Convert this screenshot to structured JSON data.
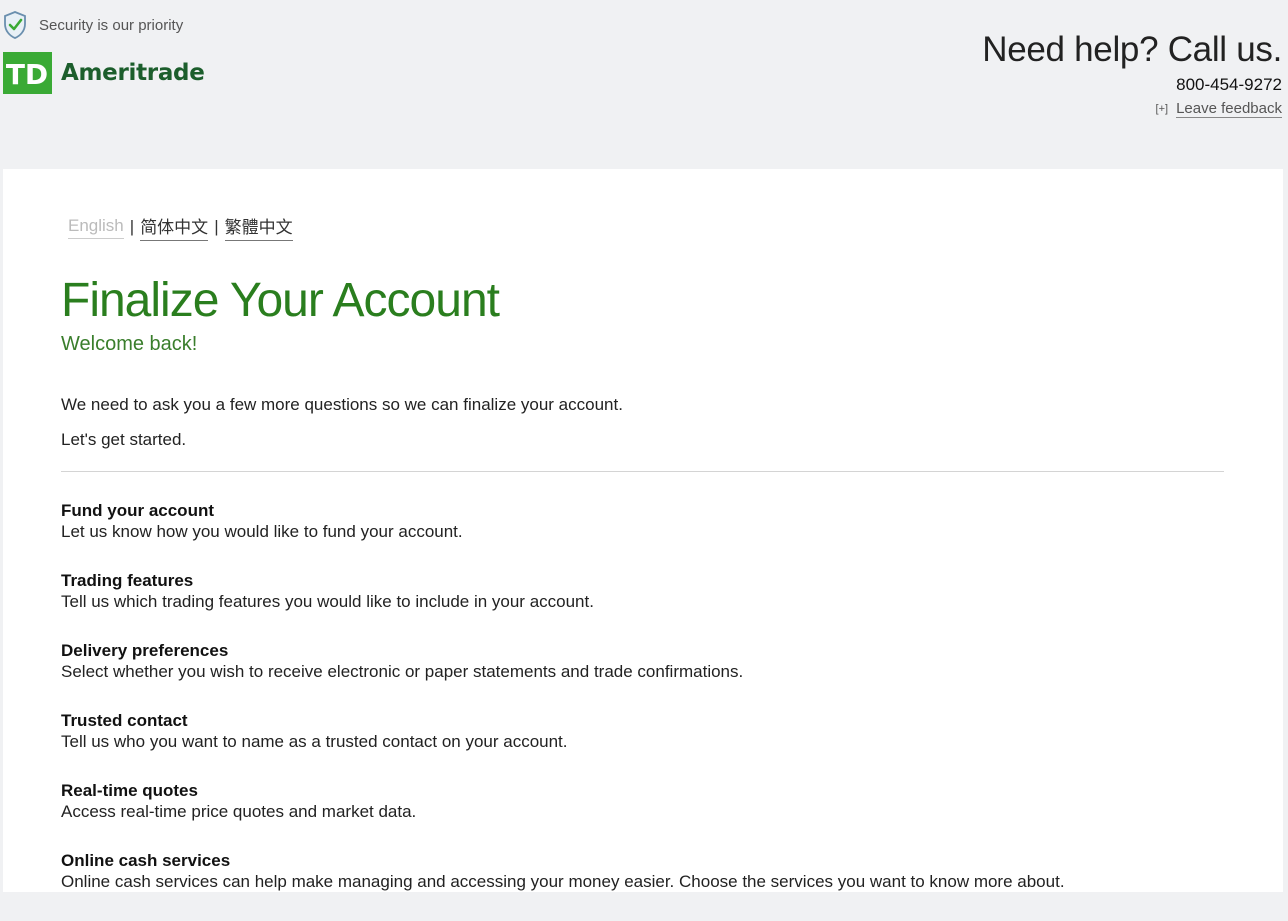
{
  "header": {
    "security_text": "Security is our priority",
    "logo_mark": "TD",
    "brand_name": "Ameritrade",
    "help_title": "Need help? Call us.",
    "phone": "800-454-9272",
    "feedback_icon": "[+]",
    "feedback_label": "Leave feedback"
  },
  "languages": {
    "items": [
      "English",
      "简体中文",
      "繁體中文"
    ],
    "separator": "|",
    "active": "English"
  },
  "main": {
    "title": "Finalize Your Account",
    "subtitle": "Welcome back!",
    "intro": "We need to ask you a few more questions so we can finalize your account.",
    "intro2": "Let's get started."
  },
  "sections": [
    {
      "title": "Fund your account",
      "description": "Let us know how you would like to fund your account."
    },
    {
      "title": "Trading features",
      "description": "Tell us which trading features you would like to include in your account."
    },
    {
      "title": "Delivery preferences",
      "description": "Select whether you wish to receive electronic or paper statements and trade confirmations."
    },
    {
      "title": "Trusted contact",
      "description": "Tell us who you want to name as a trusted contact on your account."
    },
    {
      "title": "Real-time quotes",
      "description": "Access real-time price quotes and market data."
    },
    {
      "title": "Online cash services",
      "description": "Online cash services can help make managing and accessing your money easier. Choose the services you want to know more about."
    }
  ],
  "colors": {
    "accent_green": "#2a7e1e",
    "logo_green": "#3aaa35",
    "brand_dark_green": "#1c5e2c",
    "header_bg": "#f0f1f3"
  },
  "icons": {
    "security": "shield-check-icon",
    "feedback": "plus-icon"
  }
}
